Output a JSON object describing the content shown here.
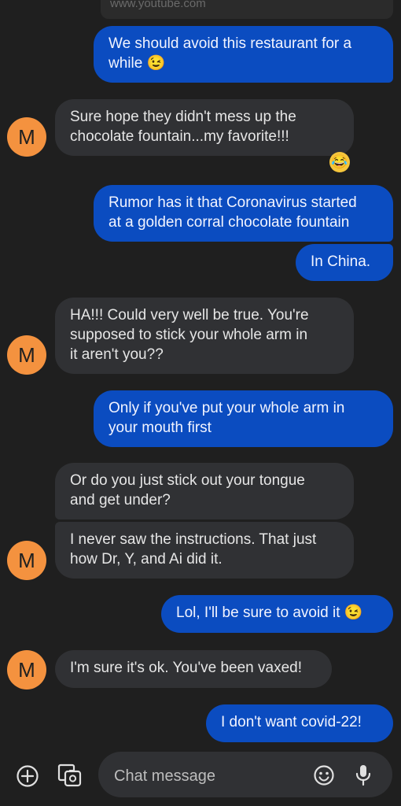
{
  "previous_link_preview": "www.youtube.com",
  "contact": {
    "initial": "M",
    "avatar_color": "#f4923f"
  },
  "colors": {
    "outgoing_bubble": "#0b4cc0",
    "incoming_bubble": "#303134",
    "background": "#1f1f1f"
  },
  "messages": [
    {
      "dir": "out",
      "text": "We should avoid this restaurant for a\nwhile 😉"
    },
    {
      "dir": "in",
      "text": "Sure hope they didn't mess up the\nchocolate fountain...my favorite!!!",
      "reaction": "😂"
    },
    {
      "dir": "out",
      "text": "Rumor has it that Coronavirus started\nat a golden corral chocolate fountain"
    },
    {
      "dir": "out",
      "text": "In China."
    },
    {
      "dir": "in",
      "text": "HA!!! Could very well be true. You're\nsupposed to stick your whole arm in\nit aren't you??"
    },
    {
      "dir": "out",
      "text": "Only if you've put your whole arm in\nyour mouth first"
    },
    {
      "dir": "in",
      "text": "Or do you just stick out your tongue\nand get under?"
    },
    {
      "dir": "in",
      "text": "I never saw the instructions. That just\nhow Dr, Y, and Ai did it."
    },
    {
      "dir": "out",
      "text": "Lol, I'll be sure to avoid it 😉"
    },
    {
      "dir": "in",
      "text": "I'm sure it's ok. You've been vaxed!"
    },
    {
      "dir": "out",
      "text": "I don't want covid-22!"
    }
  ],
  "composer": {
    "placeholder": "Chat message",
    "icons": [
      "add-circle-icon",
      "gallery-icon",
      "emoji-icon",
      "microphone-icon"
    ]
  }
}
